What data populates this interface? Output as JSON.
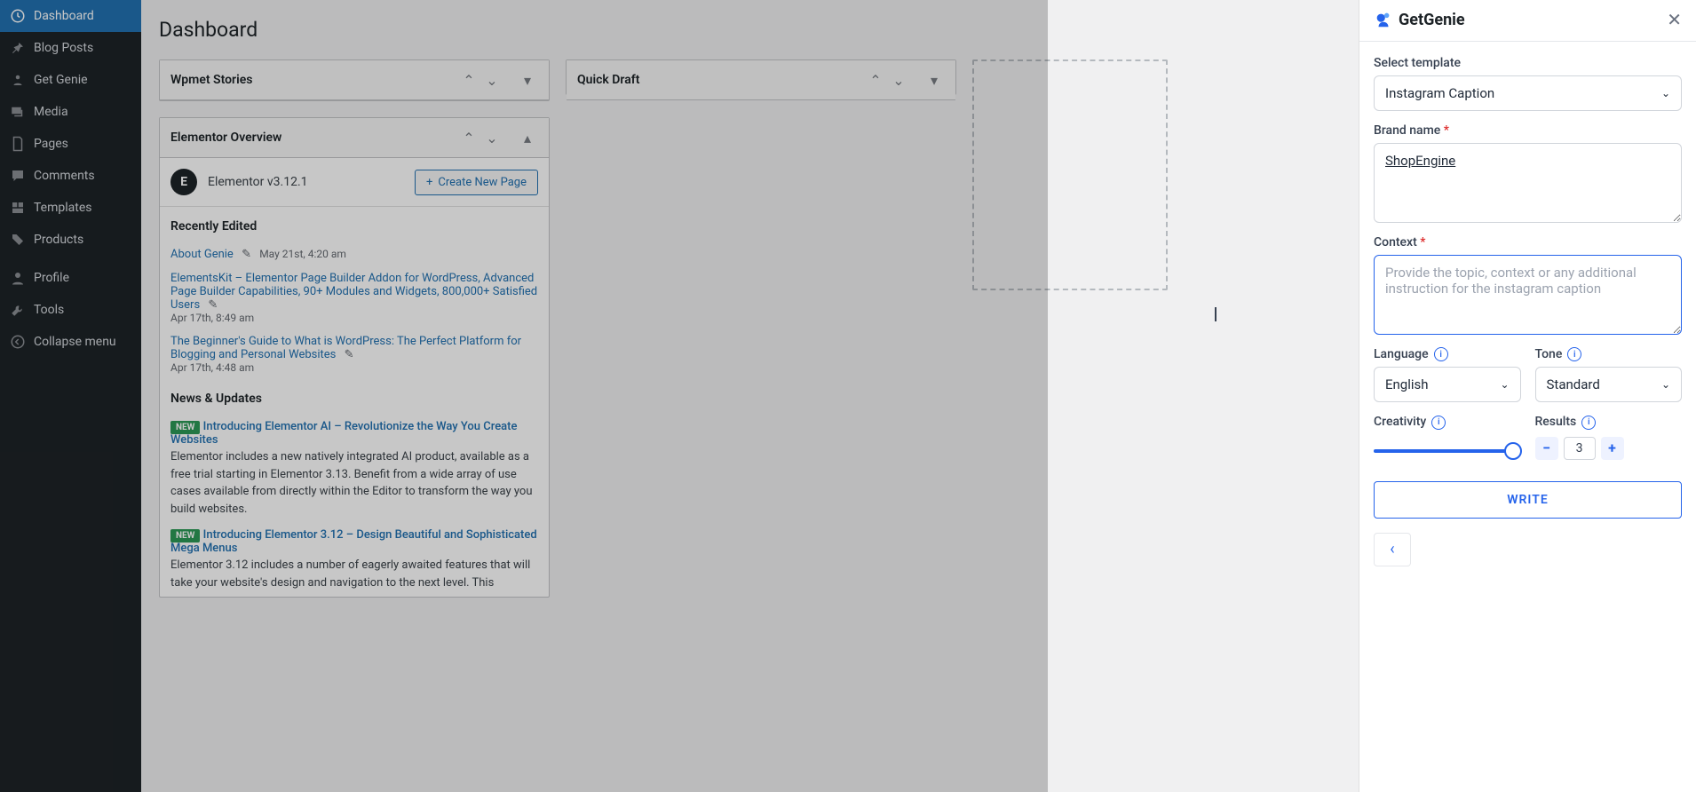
{
  "sidebar": {
    "items": [
      {
        "label": "Dashboard",
        "icon": "dashboard-icon"
      },
      {
        "label": "Blog Posts",
        "icon": "pin-icon"
      },
      {
        "label": "Get Genie",
        "icon": "genie-icon"
      },
      {
        "label": "Media",
        "icon": "media-icon"
      },
      {
        "label": "Pages",
        "icon": "pages-icon"
      },
      {
        "label": "Comments",
        "icon": "comments-icon"
      },
      {
        "label": "Templates",
        "icon": "templates-icon"
      },
      {
        "label": "Products",
        "icon": "products-icon"
      },
      {
        "label": "Profile",
        "icon": "profile-icon"
      },
      {
        "label": "Tools",
        "icon": "tools-icon"
      },
      {
        "label": "Collapse menu",
        "icon": "collapse-icon"
      }
    ]
  },
  "page": {
    "title": "Dashboard"
  },
  "panels": {
    "wpmet": {
      "title": "Wpmet Stories"
    },
    "quickdraft": {
      "title": "Quick Draft"
    },
    "elementor": {
      "title": "Elementor Overview",
      "version": "Elementor v3.12.1",
      "create_btn": "Create New Page",
      "recently_edited_title": "Recently Edited",
      "recent": [
        {
          "title": "About Genie",
          "date": "May 21st, 4:20 am"
        },
        {
          "title": "ElementsKit – Elementor Page Builder Addon for WordPress, Advanced Page Builder Capabilities, 90+ Modules and Widgets, 800,000+ Satisfied Users",
          "date": "Apr 17th, 8:49 am"
        },
        {
          "title": "The Beginner's Guide to What is WordPress: The Perfect Platform for Blogging and Personal Websites",
          "date": "Apr 17th, 4:48 am"
        }
      ],
      "news_title": "News & Updates",
      "news": [
        {
          "badge": "NEW",
          "title": "Introducing Elementor AI – Revolutionize the Way You Create Websites",
          "desc": "Elementor includes a new natively integrated AI product, available as a free trial starting in Elementor 3.13. Benefit from a wide array of use cases available from directly within the Editor to transform the way you build websites."
        },
        {
          "badge": "NEW",
          "title": "Introducing Elementor 3.12 – Design Beautiful and Sophisticated Mega Menus",
          "desc": "Elementor 3.12 includes a number of eagerly awaited features that will take your website's design and navigation to the next level. This"
        }
      ]
    }
  },
  "genie": {
    "brand": "GetGenie",
    "labels": {
      "select_template": "Select template",
      "brand_name": "Brand name",
      "context": "Context",
      "language": "Language",
      "tone": "Tone",
      "creativity": "Creativity",
      "results": "Results",
      "write": "WRITE"
    },
    "values": {
      "template": "Instagram Caption",
      "brand_name": "ShopEngine",
      "context_placeholder": "Provide the topic, context or any additional instruction for the instagram caption",
      "language": "English",
      "tone": "Standard",
      "results": "3"
    }
  }
}
